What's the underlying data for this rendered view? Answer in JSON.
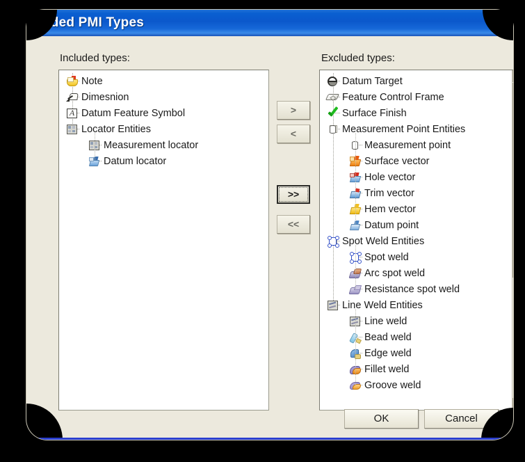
{
  "window": {
    "title": "aded PMI Types",
    "close_icon": "close-icon"
  },
  "panels": {
    "included_label": "Included types:",
    "excluded_label": "Excluded types:"
  },
  "included_tree": [
    {
      "label": "Note",
      "icon": "note-icon",
      "level": 0,
      "expander": false
    },
    {
      "label": "Dimesnion",
      "icon": "dimension-icon",
      "level": 0,
      "expander": false
    },
    {
      "label": "Datum Feature Symbol",
      "icon": "datum-feature-symbol-icon",
      "level": 0,
      "expander": false
    },
    {
      "label": "Locator Entities",
      "icon": "locator-entities-icon",
      "level": 0,
      "expander": true
    },
    {
      "label": "Measurement locator",
      "icon": "measurement-locator-icon",
      "level": 1,
      "expander": false
    },
    {
      "label": "Datum locator",
      "icon": "datum-locator-icon",
      "level": 1,
      "expander": false
    }
  ],
  "excluded_tree": [
    {
      "label": "Datum Target",
      "icon": "datum-target-icon",
      "level": 0,
      "expander": false
    },
    {
      "label": "Feature Control Frame",
      "icon": "feature-control-frame-icon",
      "level": 0,
      "expander": false
    },
    {
      "label": "Surface Finish",
      "icon": "surface-finish-icon",
      "level": 0,
      "expander": false
    },
    {
      "label": "Measurement Point Entities",
      "icon": "measurement-point-entities-icon",
      "level": 0,
      "expander": true
    },
    {
      "label": "Measurement point",
      "icon": "measurement-point-icon",
      "level": 1,
      "expander": false
    },
    {
      "label": "Surface vector",
      "icon": "surface-vector-icon",
      "level": 1,
      "expander": false
    },
    {
      "label": "Hole vector",
      "icon": "hole-vector-icon",
      "level": 1,
      "expander": false
    },
    {
      "label": "Trim vector",
      "icon": "trim-vector-icon",
      "level": 1,
      "expander": false
    },
    {
      "label": "Hem vector",
      "icon": "hem-vector-icon",
      "level": 1,
      "expander": false
    },
    {
      "label": "Datum point",
      "icon": "datum-point-icon",
      "level": 1,
      "expander": false
    },
    {
      "label": "Spot Weld Entities",
      "icon": "spot-weld-entities-icon",
      "level": 0,
      "expander": true
    },
    {
      "label": "Spot weld",
      "icon": "spot-weld-icon",
      "level": 1,
      "expander": false
    },
    {
      "label": "Arc spot weld",
      "icon": "arc-spot-weld-icon",
      "level": 1,
      "expander": false
    },
    {
      "label": "Resistance spot weld",
      "icon": "resistance-spot-weld-icon",
      "level": 1,
      "expander": false
    },
    {
      "label": "Line Weld Entities",
      "icon": "line-weld-entities-icon",
      "level": 0,
      "expander": true
    },
    {
      "label": "Line weld",
      "icon": "line-weld-icon",
      "level": 1,
      "expander": false
    },
    {
      "label": "Bead weld",
      "icon": "bead-weld-icon",
      "level": 1,
      "expander": false
    },
    {
      "label": "Edge weld",
      "icon": "edge-weld-icon",
      "level": 1,
      "expander": false
    },
    {
      "label": "Fillet weld",
      "icon": "fillet-weld-icon",
      "level": 1,
      "expander": false
    },
    {
      "label": "Groove weld",
      "icon": "groove-weld-icon",
      "level": 1,
      "expander": false
    }
  ],
  "transfer_buttons": {
    "move_right": ">",
    "move_left": "<",
    "move_all_right": ">>",
    "move_all_left": "<<"
  },
  "dialog_buttons": {
    "ok": "OK",
    "cancel": "Cancel"
  },
  "colors": {
    "titlebar_blue": "#0b58cc",
    "dialog_face": "#ece9dd",
    "list_background": "#ffffff",
    "backdrop": "#000000",
    "accent_bottom": "#2b3fd0"
  }
}
